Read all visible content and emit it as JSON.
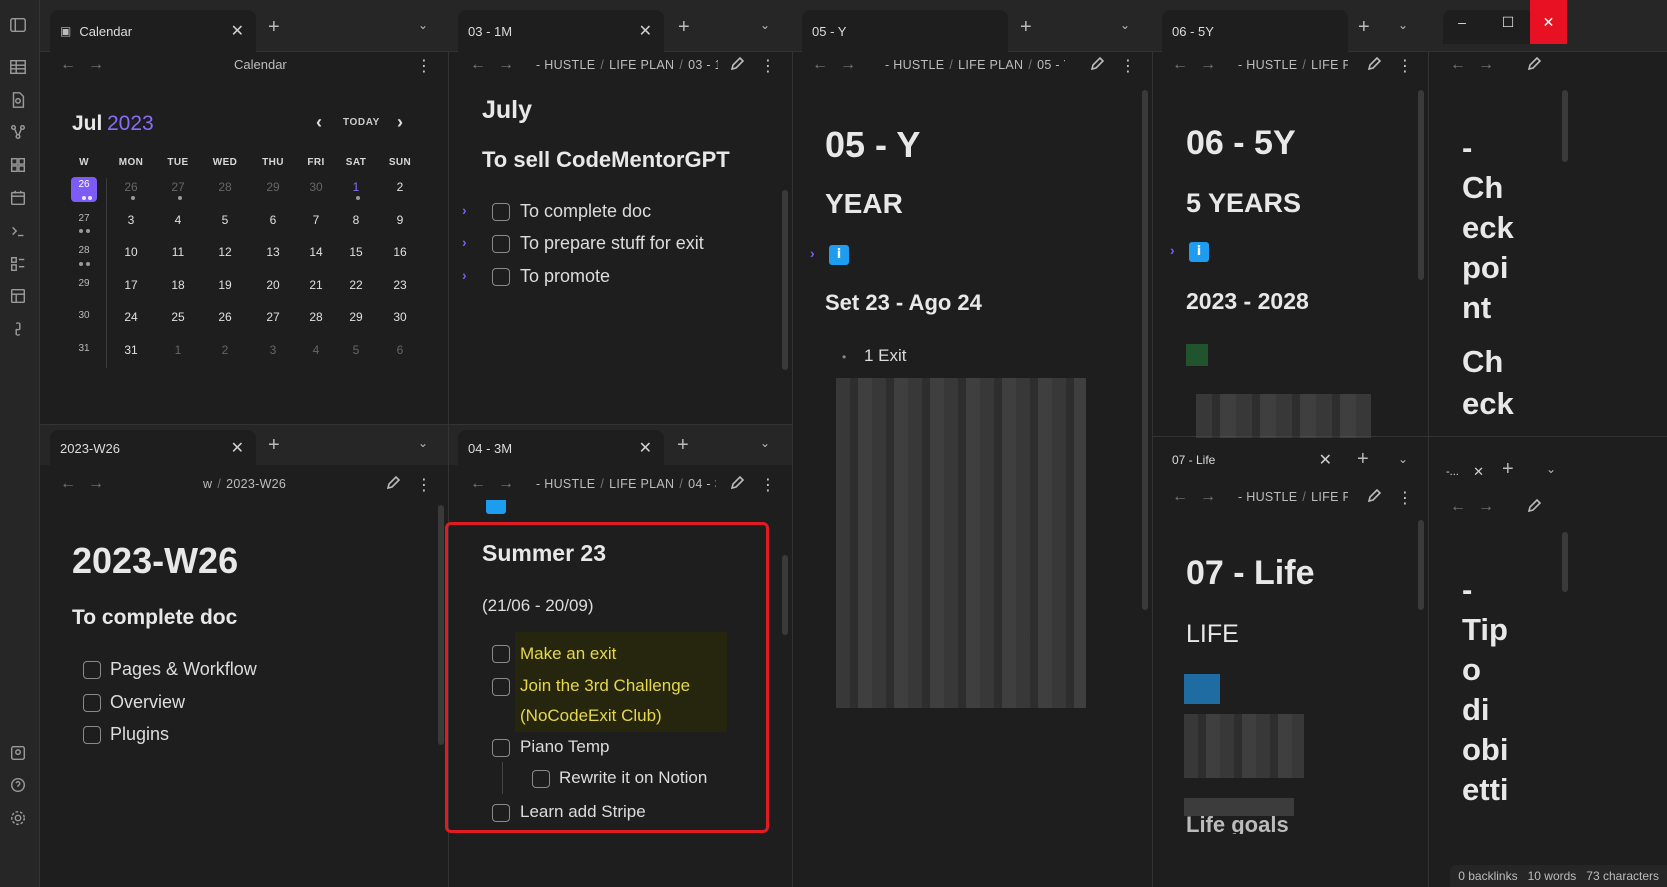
{
  "ribbon": {
    "icons": [
      "sidebar-toggle-icon",
      "table-icon",
      "file-search-icon",
      "graph-icon",
      "dashboard-icon",
      "calendar-icon",
      "terminal-icon",
      "template-icon",
      "layout-icon",
      "link-icon",
      "vault-icon",
      "help-icon",
      "settings-icon"
    ]
  },
  "window": {
    "minimize": "–",
    "maximize": "☐",
    "close": "✕"
  },
  "tabs": {
    "calendar": "Calendar",
    "t03": "03 - 1M",
    "t05": "05 - Y",
    "t06": "06 - 5Y",
    "w26": "2023-W26",
    "t04": "04 - 3M",
    "t07": "07 - Life",
    "tdots": "-..."
  },
  "calendar": {
    "header_title": "Calendar",
    "month": "Jul",
    "year": "2023",
    "today": "TODAY",
    "weekdays": [
      "W",
      "MON",
      "TUE",
      "WED",
      "THU",
      "FRI",
      "SAT",
      "SUN"
    ],
    "weeks": [
      {
        "w": "26",
        "days": [
          "26",
          "27",
          "28",
          "29",
          "30",
          "1",
          "2"
        ]
      },
      {
        "w": "27",
        "days": [
          "3",
          "4",
          "5",
          "6",
          "7",
          "8",
          "9"
        ]
      },
      {
        "w": "28",
        "days": [
          "10",
          "11",
          "12",
          "13",
          "14",
          "15",
          "16"
        ]
      },
      {
        "w": "29",
        "days": [
          "17",
          "18",
          "19",
          "20",
          "21",
          "22",
          "23"
        ]
      },
      {
        "w": "30",
        "days": [
          "24",
          "25",
          "26",
          "27",
          "28",
          "29",
          "30"
        ]
      },
      {
        "w": "31",
        "days": [
          "31",
          "1",
          "2",
          "3",
          "4",
          "5",
          "6"
        ]
      }
    ]
  },
  "p03": {
    "crumb": [
      "- HUSTLE",
      "LIFE PLAN",
      "03 - 1"
    ],
    "title": "July",
    "heading": "To sell CodeMentorGPT",
    "tasks": [
      "To complete doc",
      "To prepare stuff for exit",
      "To promote"
    ]
  },
  "p05": {
    "crumb": [
      "- HUSTLE",
      "LIFE PLAN",
      "05 - Y"
    ],
    "title": "05 - Y",
    "h2": "YEAR",
    "info": "i",
    "h3": "Set 23 - Ago 24",
    "bullet": "1 Exit"
  },
  "p06": {
    "crumb": [
      "- HUSTLE",
      "LIFE P"
    ],
    "title": "06 - 5Y",
    "h2": "5 YEARS",
    "info": "i",
    "h3": "2023 - 2028"
  },
  "p07": {
    "crumb": [
      "- HUSTLE",
      "LIFE P"
    ],
    "title": "07 - Life",
    "h2": "LIFE",
    "partial": "Life goals"
  },
  "pcheck": {
    "lines": [
      "-",
      "Ch",
      "eck",
      "poi",
      "nt",
      "Ch",
      "eck"
    ]
  },
  "ptipo": {
    "lines": [
      "-",
      "Tip",
      "o",
      "di",
      "obi",
      "etti"
    ]
  },
  "w26": {
    "crumb": [
      "w",
      "2023-W26"
    ],
    "title": "2023-W26",
    "heading": "To complete doc",
    "tasks": [
      "Pages & Workflow",
      "Overview",
      "Plugins"
    ]
  },
  "p04": {
    "crumb": [
      "- HUSTLE",
      "LIFE PLAN",
      "04 - 3"
    ],
    "title": "Summer 23",
    "range": "(21/06 - 20/09)",
    "tasks": [
      "Make an exit",
      "Join the 3rd Challenge",
      "(NoCodeExit Club)",
      "Piano Temp",
      "Rewrite it on Notion",
      "Learn add Stripe"
    ],
    "highlight_color": "#e6d84a"
  },
  "status": {
    "backlinks": "0 backlinks",
    "words": "10 words",
    "chars": "73 characters"
  }
}
